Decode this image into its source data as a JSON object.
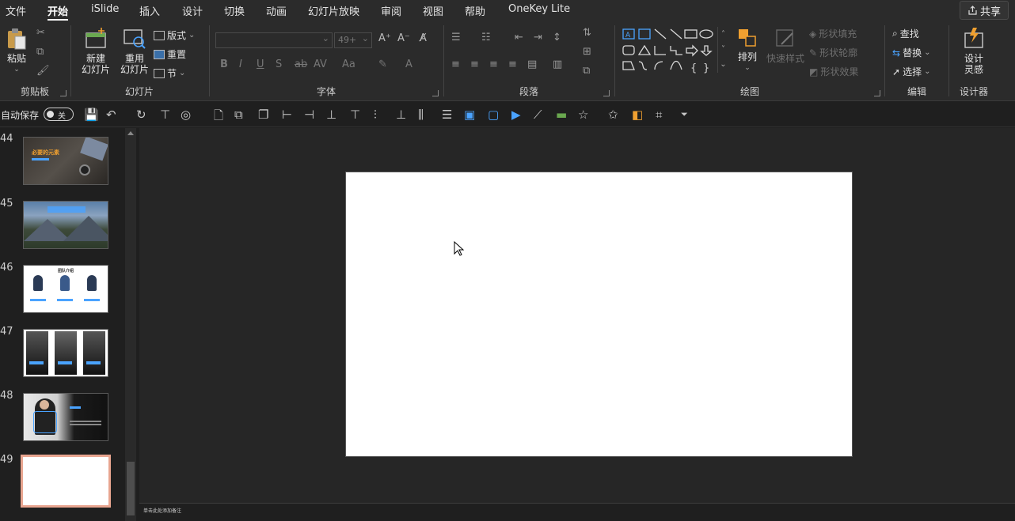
{
  "menu": {
    "tabs": [
      "文件",
      "开始",
      "iSlide",
      "插入",
      "设计",
      "切换",
      "动画",
      "幻灯片放映",
      "审阅",
      "视图",
      "帮助",
      "OneKey Lite"
    ],
    "active_tab": "开始",
    "share_label": "共享"
  },
  "ribbon": {
    "clipboard": {
      "group_label": "剪贴板",
      "paste_label": "粘贴"
    },
    "slides": {
      "group_label": "幻灯片",
      "new_slide_line1": "新建",
      "new_slide_line2": "幻灯片",
      "reuse_line1": "重用",
      "reuse_line2": "幻灯片",
      "layout_label": "版式",
      "reset_label": "重置",
      "section_label": "节"
    },
    "font": {
      "group_label": "字体",
      "font_name": "",
      "font_size": "49+"
    },
    "paragraph": {
      "group_label": "段落"
    },
    "drawing": {
      "group_label": "绘图",
      "arrange_label": "排列",
      "quick_styles_label": "快速样式",
      "shape_fill_label": "形状填充",
      "shape_outline_label": "形状轮廓",
      "shape_effects_label": "形状效果"
    },
    "editing": {
      "group_label": "编辑",
      "find_label": "查找",
      "replace_label": "替换",
      "select_label": "选择"
    },
    "designer": {
      "group_label": "设计器",
      "design_ideas_line1": "设计",
      "design_ideas_line2": "灵感"
    }
  },
  "qat": {
    "autosave_label": "自动保存",
    "autosave_state": "关"
  },
  "thumbnails": [
    {
      "number": "44",
      "title": "必要的元素"
    },
    {
      "number": "45",
      "title": ""
    },
    {
      "number": "46",
      "title": "团队介绍"
    },
    {
      "number": "47",
      "title": ""
    },
    {
      "number": "48",
      "title": ""
    },
    {
      "number": "49",
      "title": ""
    }
  ],
  "notes_text": "单击此处添加备注",
  "colors": {
    "accent_selected_border": "#e8a590",
    "ribbon_bg": "#2b2b2b",
    "app_bg": "#1f1f1f",
    "orange_icon": "#f0a030",
    "blue_icon": "#4aa3ff"
  }
}
